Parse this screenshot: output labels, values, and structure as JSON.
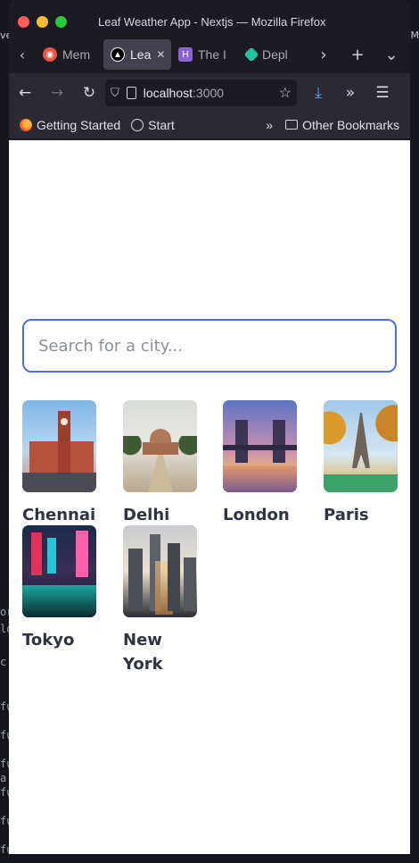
{
  "window": {
    "title": "Leaf Weather App - Nextjs — Mozilla Firefox"
  },
  "tabs": [
    {
      "label": "Mem",
      "icon": "meme-icon",
      "color": "#e8553c",
      "active": false
    },
    {
      "label": "Lea",
      "icon": "nextjs-icon",
      "color": "#000000",
      "active": true
    },
    {
      "label": "The I",
      "icon": "heroku-icon",
      "color": "#8a63d2",
      "active": false
    },
    {
      "label": "Depl",
      "icon": "netlify-icon",
      "color": "#25c2a0",
      "active": false
    }
  ],
  "address": {
    "host": "localhost",
    "port": ":3000"
  },
  "bookmarks": {
    "getting_started": "Getting Started",
    "start": "Start",
    "other": "Other Bookmarks"
  },
  "search": {
    "placeholder": "Search for a city..."
  },
  "cities": [
    {
      "name": "Chennai"
    },
    {
      "name": "Delhi"
    },
    {
      "name": "London"
    },
    {
      "name": "Paris"
    },
    {
      "name": "Tokyo"
    },
    {
      "name": "New York"
    }
  ],
  "background": {
    "left_tab_fragment": "ve",
    "right_tab_fragment": "OM",
    "terminal_lines": [
      "or",
      "lo",
      "c",
      "fu",
      "fu",
      "fu",
      "a",
      "fu",
      "fu",
      "fu"
    ]
  },
  "colors": {
    "search_border": "#4f6fd8",
    "city_text": "#2e3440",
    "chrome_dark": "#1c1b22",
    "chrome": "#2b2a33"
  }
}
